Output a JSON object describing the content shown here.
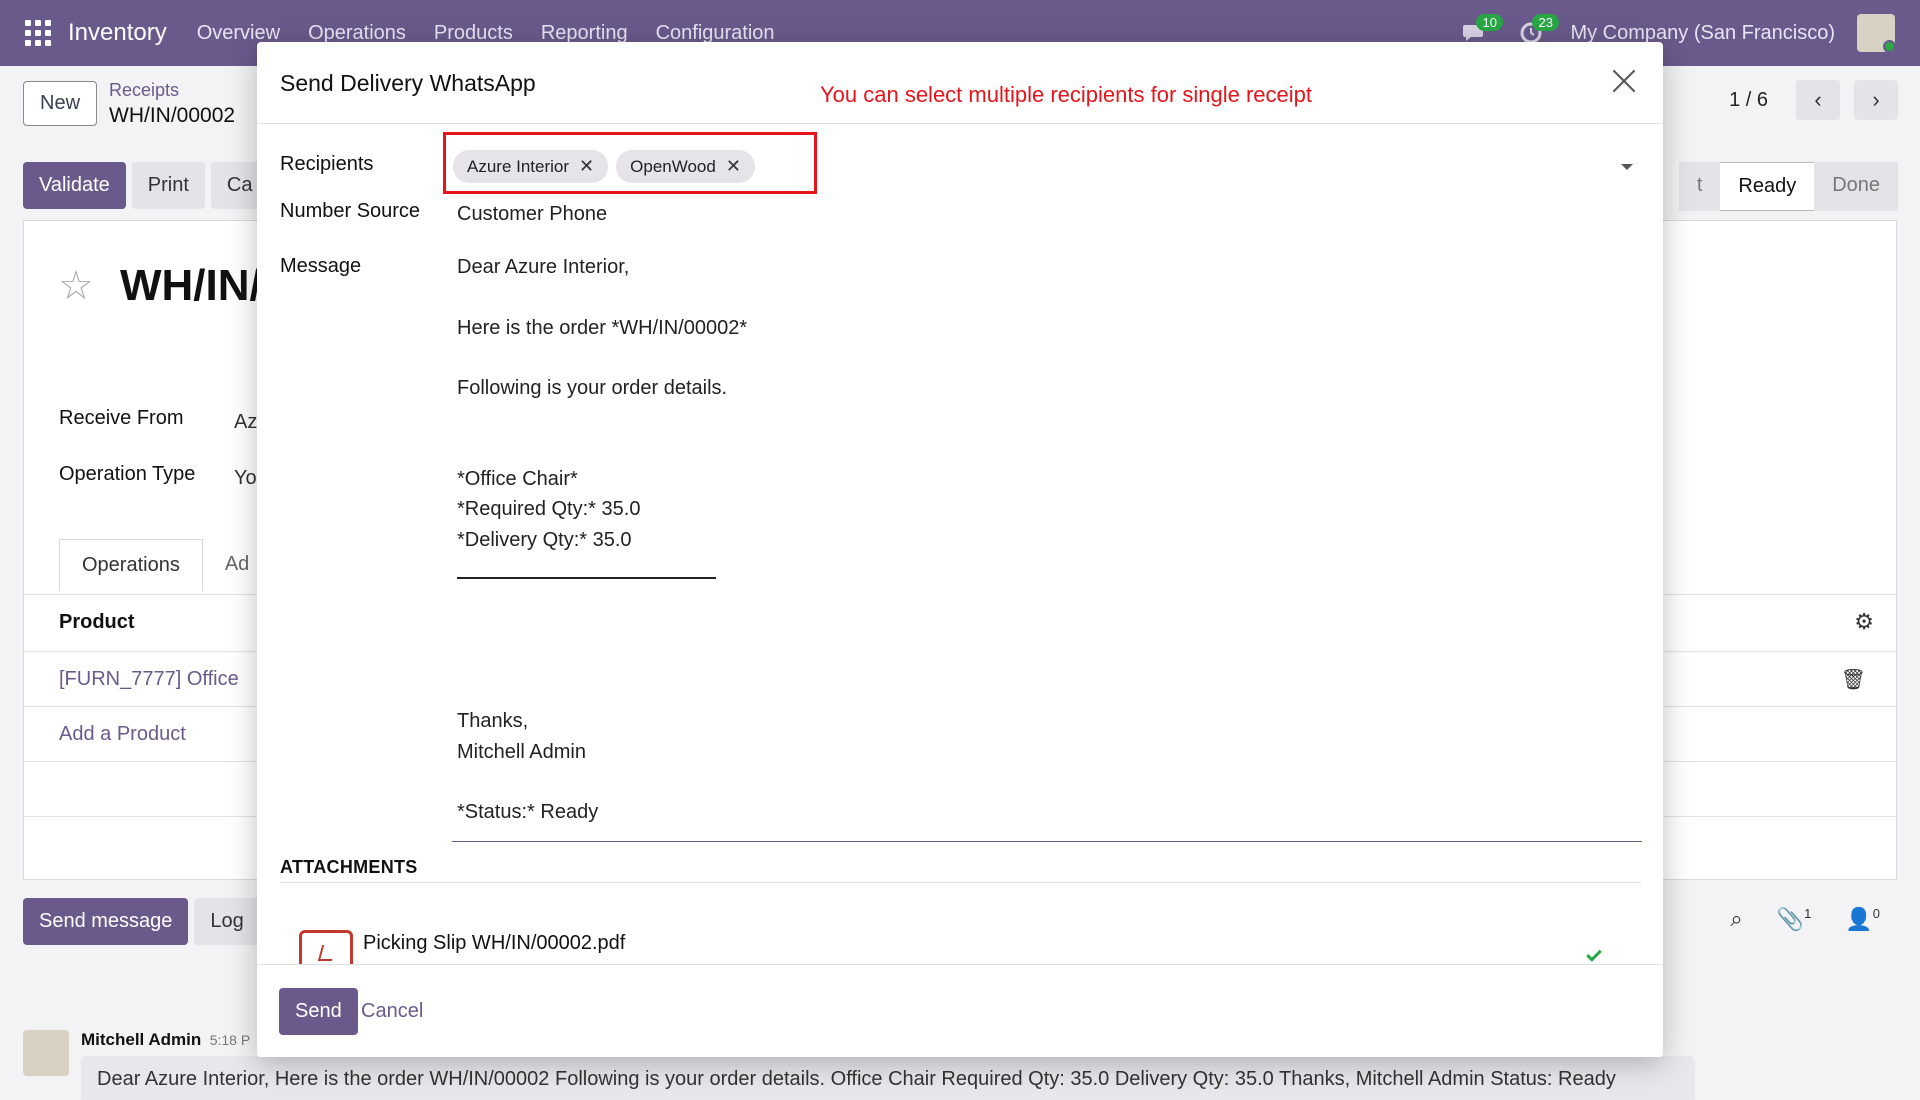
{
  "topnav": {
    "app_name": "Inventory",
    "menu": [
      "Overview",
      "Operations",
      "Products",
      "Reporting",
      "Configuration"
    ],
    "chat_count": "10",
    "activity_count": "23",
    "company": "My Company (San Francisco)"
  },
  "control_panel": {
    "new_label": "New",
    "breadcrumb_parent": "Receipts",
    "breadcrumb_current": "WH/IN/00002",
    "pager": "1 / 6"
  },
  "actions": {
    "validate": "Validate",
    "print": "Print",
    "cancel_partial": "Ca"
  },
  "statusbar": {
    "partial": "t",
    "ready": "Ready",
    "done": "Done"
  },
  "form": {
    "title_partial": "WH/IN/(",
    "receive_from_label": "Receive From",
    "receive_from_value": "Az",
    "operation_type_label": "Operation Type",
    "operation_type_value": "Yo",
    "tab_operations": "Operations",
    "tab_additional": "Ad",
    "product_header": "Product",
    "product_row": "[FURN_7777] Office",
    "add_product": "Add a Product"
  },
  "chatter": {
    "send_message": "Send message",
    "log_note": "Log",
    "attachments_count": "1",
    "followers_count": "0",
    "author": "Mitchell Admin",
    "time": "5:18 P",
    "message": "Dear Azure Interior, Here is the order WH/IN/00002 Following is your order details. Office Chair Required Qty: 35.0 Delivery Qty: 35.0 Thanks, Mitchell Admin Status: Ready"
  },
  "modal": {
    "title": "Send Delivery WhatsApp",
    "annotation": "You can select multiple recipients for single receipt",
    "annotation_color": "#e8141b",
    "recipients_label": "Recipients",
    "recipients": [
      "Azure Interior",
      "OpenWood"
    ],
    "number_source_label": "Number Source",
    "number_source_value": "Customer Phone",
    "message_label": "Message",
    "message_body": "Dear Azure Interior,\n\nHere is the order *WH/IN/00002*\n\nFollowing is your order details.\n\n\n*Office Chair*\n*Required Qty:* 35.0\n*Delivery Qty:* 35.0\n\n\n\n\n\nThanks,\nMitchell Admin\n\n*Status:* Ready",
    "attachments_title": "ATTACHMENTS",
    "attachment_name": "Picking Slip WH/IN/00002.pdf",
    "send_label": "Send",
    "cancel_label": "Cancel"
  },
  "colors": {
    "brand": "#6a5a8c",
    "success": "#28a745"
  }
}
